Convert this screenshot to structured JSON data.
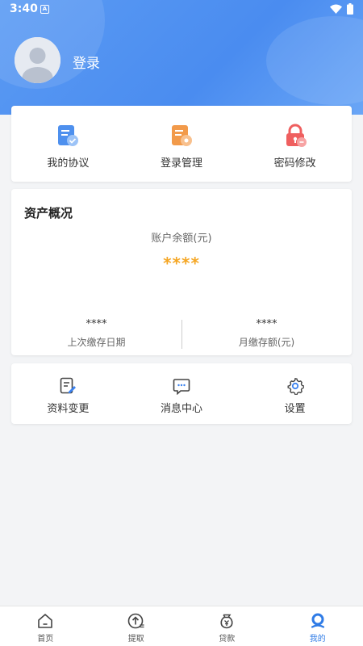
{
  "status_bar": {
    "time": "3:40",
    "notification_icon": "A"
  },
  "header": {
    "login_label": "登录"
  },
  "quick_actions": [
    {
      "label": "我的协议",
      "icon": "agreement-icon"
    },
    {
      "label": "登录管理",
      "icon": "login-manage-icon"
    },
    {
      "label": "密码修改",
      "icon": "password-lock-icon"
    }
  ],
  "assets": {
    "title": "资产概况",
    "balance_label": "账户余额(元)",
    "balance_value": "****",
    "last_deposit_value": "****",
    "last_deposit_label": "上次缴存日期",
    "monthly_deposit_value": "****",
    "monthly_deposit_label": "月缴存额(元)"
  },
  "more_actions": [
    {
      "label": "资料变更",
      "icon": "edit-doc-icon"
    },
    {
      "label": "消息中心",
      "icon": "message-icon"
    },
    {
      "label": "设置",
      "icon": "gear-icon"
    }
  ],
  "tabbar": [
    {
      "label": "首页",
      "icon": "home-icon",
      "active": false
    },
    {
      "label": "提取",
      "icon": "withdraw-icon",
      "active": false
    },
    {
      "label": "贷款",
      "icon": "loan-icon",
      "active": false
    },
    {
      "label": "我的",
      "icon": "profile-icon",
      "active": true
    }
  ],
  "colors": {
    "primary": "#4a8cf0",
    "accent_orange": "#f5a623",
    "active_tab": "#2f7be6"
  }
}
